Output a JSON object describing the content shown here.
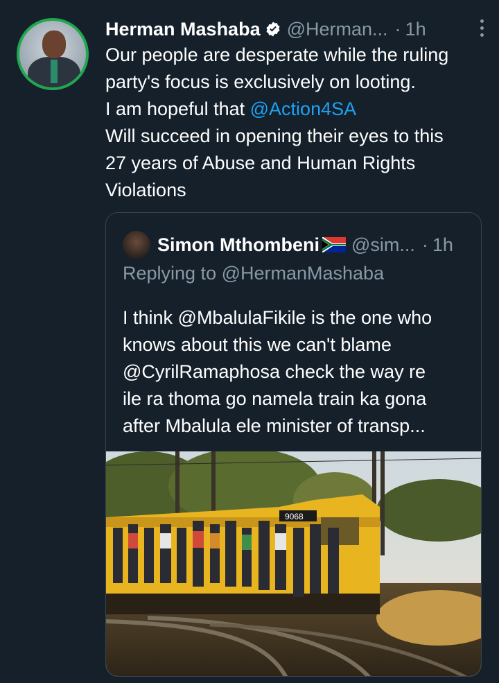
{
  "tweet": {
    "author_name": "Herman Mashaba",
    "handle": "@Herman...",
    "separator": "·",
    "time": "1h",
    "lines": [
      "Our people are desperate while the ruling",
      "party's focus is exclusively on looting.",
      "I am hopeful that "
    ],
    "mention": "@Action4SA",
    "lines_after": [
      "Will succeed in opening their eyes to this",
      "27 years of Abuse and Human Rights",
      "Violations"
    ]
  },
  "quoted": {
    "author_name": "Simon Mthombeni",
    "flag_icon": "south-africa-flag-icon",
    "handle": "@sim...",
    "separator": "·",
    "time": "1h",
    "replying_to": "Replying to @HermanMashaba",
    "lines": [
      "I think @MbalulaFikile is the one who",
      "knows about this we can't blame",
      "@CyrilRamaphosa check the way re",
      "ile ra thoma go namela train ka gona",
      "after Mbalula ele minister of transp..."
    ],
    "train_number": "9068"
  },
  "colors": {
    "background": "#15202b",
    "secondary_text": "#8899a6",
    "link": "#1da1f2",
    "border": "#38444d",
    "avatar_ring": "#1fa84f",
    "train_yellow": "#e8b520"
  },
  "icons": {
    "verified": "verified-badge-icon",
    "more": "more-vertical-icon"
  }
}
